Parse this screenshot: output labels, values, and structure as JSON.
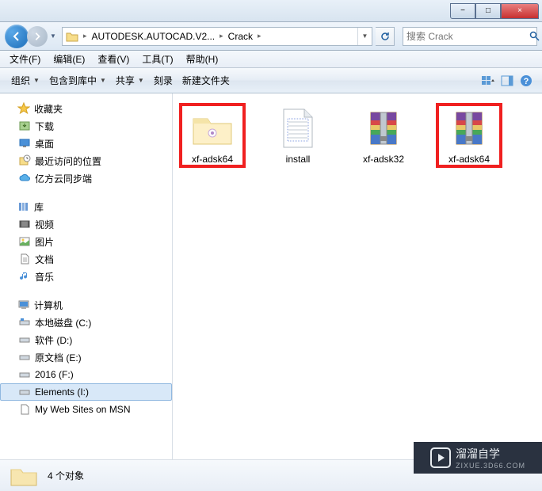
{
  "window": {
    "title_min": "−",
    "title_max": "□",
    "title_close": "×"
  },
  "nav": {
    "back_glyph": "←",
    "fwd_glyph": "→",
    "dd_glyph": "▼",
    "breadcrumb": [
      {
        "label": "AUTODESK.AUTOCAD.V2..."
      },
      {
        "label": "Crack"
      }
    ],
    "sep": "▸",
    "refresh_glyph": "↻"
  },
  "search": {
    "placeholder": "搜索 Crack",
    "icon_glyph": "🔍"
  },
  "menu": [
    {
      "label": "文件(F)"
    },
    {
      "label": "编辑(E)"
    },
    {
      "label": "查看(V)"
    },
    {
      "label": "工具(T)"
    },
    {
      "label": "帮助(H)"
    }
  ],
  "toolbar": {
    "organize": "组织",
    "include": "包含到库中",
    "share": "共享",
    "burn": "刻录",
    "newfolder": "新建文件夹"
  },
  "sidebar": {
    "favorites": {
      "label": "收藏夹",
      "items": [
        {
          "label": "下载",
          "icon": "download"
        },
        {
          "label": "桌面",
          "icon": "desktop"
        },
        {
          "label": "最近访问的位置",
          "icon": "recent"
        },
        {
          "label": "亿方云同步端",
          "icon": "cloud"
        }
      ]
    },
    "libraries": {
      "label": "库",
      "items": [
        {
          "label": "视频",
          "icon": "video"
        },
        {
          "label": "图片",
          "icon": "picture"
        },
        {
          "label": "文档",
          "icon": "doc"
        },
        {
          "label": "音乐",
          "icon": "music"
        }
      ]
    },
    "computer": {
      "label": "计算机",
      "items": [
        {
          "label": "本地磁盘 (C:)",
          "icon": "drive-sys"
        },
        {
          "label": "软件 (D:)",
          "icon": "drive"
        },
        {
          "label": "原文档 (E:)",
          "icon": "drive"
        },
        {
          "label": "2016 (F:)",
          "icon": "drive"
        },
        {
          "label": "Elements (I:)",
          "icon": "drive",
          "selected": true
        },
        {
          "label": "My Web Sites on MSN",
          "icon": "doc"
        }
      ]
    }
  },
  "files": [
    {
      "name": "xf-adsk64",
      "type": "folder",
      "highlight": true
    },
    {
      "name": "install",
      "type": "text",
      "highlight": false
    },
    {
      "name": "xf-adsk32",
      "type": "rar",
      "highlight": false
    },
    {
      "name": "xf-adsk64",
      "type": "rar",
      "highlight": true
    }
  ],
  "status": {
    "count": "4 个对象"
  },
  "watermark": {
    "brand": "溜溜自学",
    "sub": "ZIXUE.3D66.COM"
  }
}
